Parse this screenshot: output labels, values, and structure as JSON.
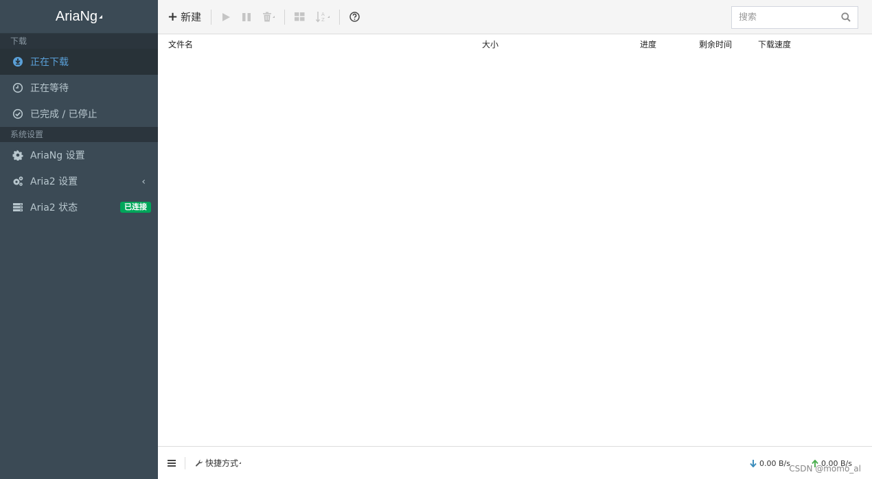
{
  "app": {
    "title": "AriaNg"
  },
  "sidebar": {
    "sections": [
      {
        "header": "下载",
        "items": [
          {
            "label": "正在下载",
            "icon": "download-circle-icon",
            "active": true
          },
          {
            "label": "正在等待",
            "icon": "clock-icon"
          },
          {
            "label": "已完成 / 已停止",
            "icon": "check-circle-icon"
          }
        ]
      },
      {
        "header": "系统设置",
        "items": [
          {
            "label": "AriaNg 设置",
            "icon": "gear-icon"
          },
          {
            "label": "Aria2 设置",
            "icon": "gears-icon",
            "arrow": "‹"
          },
          {
            "label": "Aria2 状态",
            "icon": "server-icon",
            "badge": "已连接"
          }
        ]
      }
    ]
  },
  "toolbar": {
    "new_label": "新建",
    "search": {
      "placeholder": "搜索",
      "value": ""
    }
  },
  "table": {
    "columns": [
      "文件名",
      "大小",
      "进度",
      "剩余时间",
      "下载速度"
    ]
  },
  "footer": {
    "shortcut_label": "快捷方式",
    "download_speed": "0.00 B/s",
    "upload_speed": "0.00 B/s",
    "watermark": "CSDN @momo_al"
  },
  "colors": {
    "sidebar_bg": "#3b4a55",
    "active_bg": "#283238",
    "accent": "#3c8dbc",
    "badge_green": "#00a65a"
  }
}
